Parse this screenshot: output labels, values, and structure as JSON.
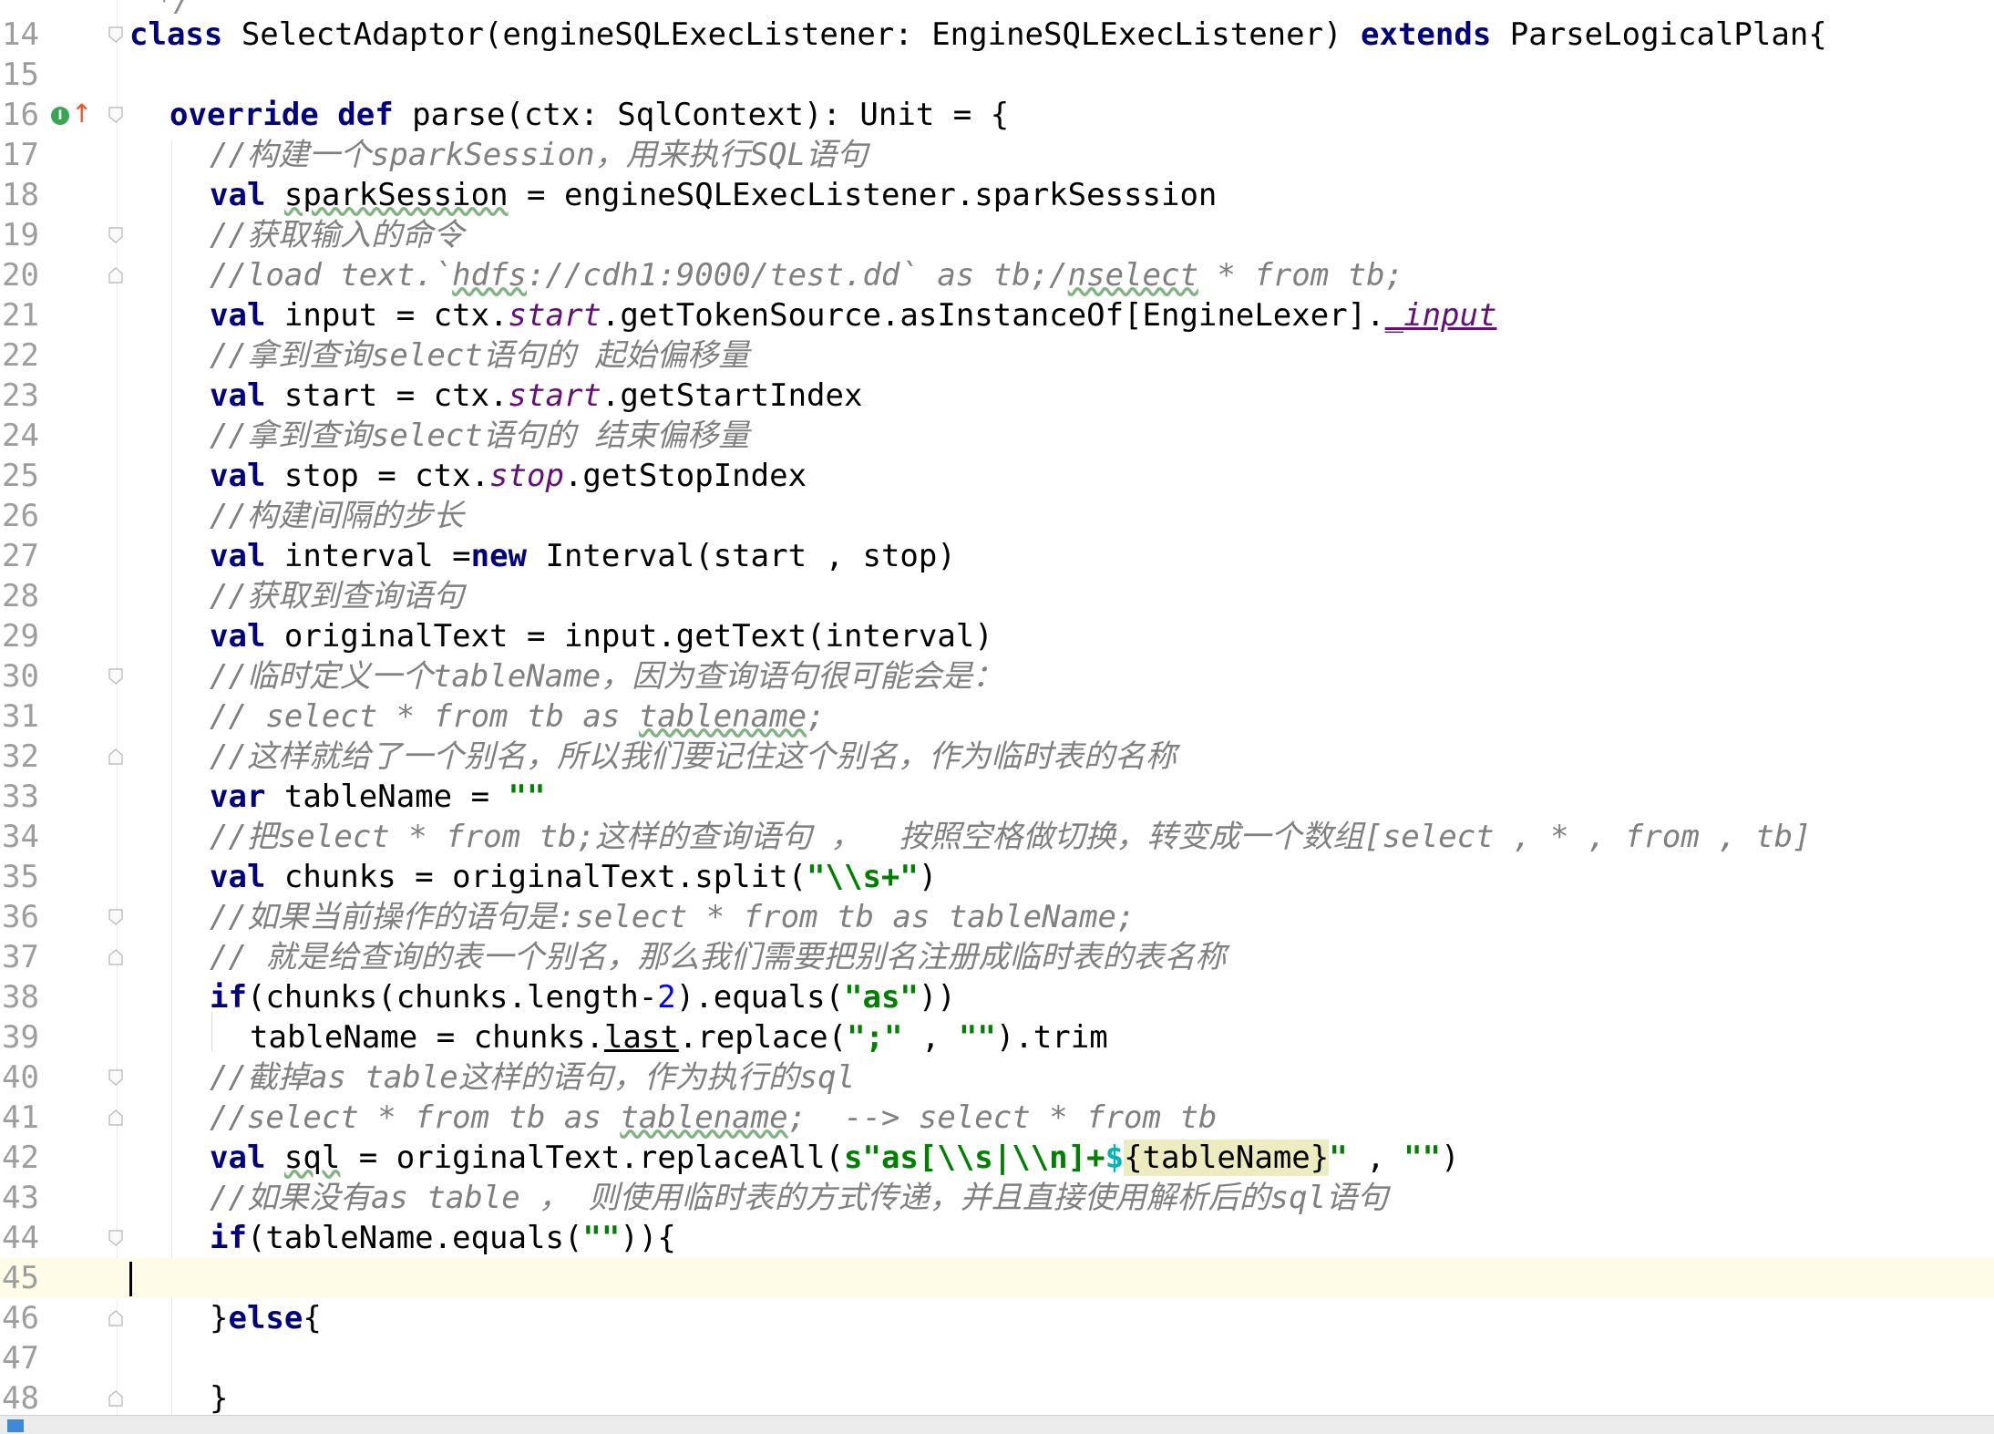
{
  "editor": {
    "top_partial_text": "*/",
    "current_line_number": "45",
    "lines": [
      {
        "num": "14"
      },
      {
        "num": "15"
      },
      {
        "num": "16"
      },
      {
        "num": "17"
      },
      {
        "num": "18"
      },
      {
        "num": "19"
      },
      {
        "num": "20"
      },
      {
        "num": "21"
      },
      {
        "num": "22"
      },
      {
        "num": "23"
      },
      {
        "num": "24"
      },
      {
        "num": "25"
      },
      {
        "num": "26"
      },
      {
        "num": "27"
      },
      {
        "num": "28"
      },
      {
        "num": "29"
      },
      {
        "num": "30"
      },
      {
        "num": "31"
      },
      {
        "num": "32"
      },
      {
        "num": "33"
      },
      {
        "num": "34"
      },
      {
        "num": "35"
      },
      {
        "num": "36"
      },
      {
        "num": "37"
      },
      {
        "num": "38"
      },
      {
        "num": "39"
      },
      {
        "num": "40"
      },
      {
        "num": "41"
      },
      {
        "num": "42"
      },
      {
        "num": "43"
      },
      {
        "num": "44"
      },
      {
        "num": "45"
      },
      {
        "num": "46"
      },
      {
        "num": "47"
      },
      {
        "num": "48"
      }
    ],
    "code": {
      "l14": {
        "kw_class": "class",
        "t1": " SelectAdaptor(engineSQLExecListener: EngineSQLExecListener) ",
        "kw_extends": "extends",
        "t2": " ParseLogicalPlan{"
      },
      "l16": {
        "kw1": "override",
        "sp": " ",
        "kw2": "def",
        "t1": " parse(ctx: SqlContext): Unit = {"
      },
      "l17": {
        "c": "//构建一个sparkSession，用来执行SQL语句"
      },
      "l18": {
        "kw": "val",
        "t1": " ",
        "u": "sparkSession",
        "t2": " = engineSQLExecListener.sparkSesssion"
      },
      "l19": {
        "c": "//获取输入的命令"
      },
      "l20": {
        "c1": "//load text.`",
        "u1": "hdfs",
        "c2": "://cdh1:9000/test.dd` as tb;/",
        "u2": "nselect",
        "c3": " * from tb;"
      },
      "l21": {
        "kw": "val",
        "t1": " input = ctx.",
        "f1": "start",
        "t2": ".getTokenSource.asInstanceOf[EngineLexer].",
        "f2": "_input"
      },
      "l22": {
        "c": "//拿到查询select语句的 起始偏移量"
      },
      "l23": {
        "kw": "val",
        "t1": " start = ctx.",
        "f1": "start",
        "t2": ".getStartIndex"
      },
      "l24": {
        "c": "//拿到查询select语句的 结束偏移量"
      },
      "l25": {
        "kw": "val",
        "t1": " stop = ctx.",
        "f1": "stop",
        "t2": ".getStopIndex"
      },
      "l26": {
        "c": "//构建间隔的步长"
      },
      "l27": {
        "kw": "val",
        "t1": " interval =",
        "kw2": "new",
        "t2": " Interval(start , stop)"
      },
      "l28": {
        "c": "//获取到查询语句"
      },
      "l29": {
        "kw": "val",
        "t1": " originalText = input.getText(interval)"
      },
      "l30": {
        "c": "//临时定义一个tableName，因为查询语句很可能会是："
      },
      "l31": {
        "c1": "// select * from tb as ",
        "u": "tablename",
        "c2": ";"
      },
      "l32": {
        "c": "//这样就给了一个别名，所以我们要记住这个别名，作为临时表的名称"
      },
      "l33": {
        "kw": "var",
        "t1": " tableName = ",
        "s": "\"\""
      },
      "l34": {
        "c": "//把select * from tb;这样的查询语句 ，  按照空格做切换，转变成一个数组[select , * , from , tb]"
      },
      "l35": {
        "kw": "val",
        "t1": " chunks = originalText.split(",
        "s": "\"\\\\s+\"",
        "t2": ")"
      },
      "l36": {
        "c": "//如果当前操作的语句是:select * from tb as tableName;"
      },
      "l37": {
        "c": "// 就是给查询的表一个别名，那么我们需要把别名注册成临时表的表名称"
      },
      "l38": {
        "kw": "if",
        "t1": "(chunks(chunks.length-",
        "n": "2",
        "t2": ").equals(",
        "s": "\"as\"",
        "t3": "))"
      },
      "l39": {
        "t1": "tableName = chunks.",
        "u": "last",
        "t2": ".replace(",
        "s1": "\";\"",
        "t3": " , ",
        "s2": "\"\"",
        "t4": ").trim"
      },
      "l40": {
        "c": "//截掉as table这样的语句，作为执行的sql"
      },
      "l41": {
        "c1": "//select * from tb as ",
        "u": "tablename",
        "c2": ";  --> select * from tb"
      },
      "l42": {
        "kw": "val",
        "t1": " ",
        "u": "sql",
        "t2": " = originalText.replaceAll(",
        "s1": "s\"as[\\\\s|\\\\n]+",
        "i1": "$",
        "h": "{tableName}",
        "s2": "\"",
        "t3": " , ",
        "s3": "\"\"",
        "t4": ")"
      },
      "l43": {
        "c": "//如果没有as table ， 则使用临时表的方式传递，并且直接使用解析后的sql语句"
      },
      "l44": {
        "kw": "if",
        "t1": "(tableName.equals(",
        "s": "\"\"",
        "t2": ")){"
      },
      "l46": {
        "t1": "}",
        "kw": "else",
        "t2": "{"
      },
      "l48": {
        "t1": "}"
      }
    }
  }
}
